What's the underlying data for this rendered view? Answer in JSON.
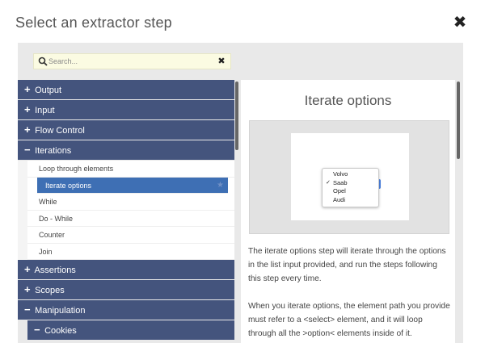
{
  "dialog": {
    "title": "Select an extractor step",
    "close_label": "✖"
  },
  "search": {
    "placeholder": "Search...",
    "clear_label": "✖"
  },
  "categories": [
    {
      "label": "Output",
      "sign": "+",
      "expanded": false
    },
    {
      "label": "Input",
      "sign": "+",
      "expanded": false
    },
    {
      "label": "Flow Control",
      "sign": "+",
      "expanded": false
    },
    {
      "label": "Iterations",
      "sign": "−",
      "expanded": true,
      "items": [
        {
          "label": "Loop through elements"
        },
        {
          "label": "Iterate options",
          "selected": true
        },
        {
          "label": "While"
        },
        {
          "label": "Do - While"
        },
        {
          "label": "Counter"
        },
        {
          "label": "Join"
        }
      ]
    },
    {
      "label": "Assertions",
      "sign": "+",
      "expanded": false
    },
    {
      "label": "Scopes",
      "sign": "+",
      "expanded": false
    },
    {
      "label": "Manipulation",
      "sign": "−",
      "expanded": true
    },
    {
      "label": "Cookies",
      "sign": "−",
      "expanded": true,
      "sub": true
    }
  ],
  "preview": {
    "title": "Iterate options",
    "options": [
      "Volvo",
      "Saab",
      "Opel",
      "Audi"
    ],
    "checked_option": "Saab",
    "description": [
      "The iterate options step will iterate through the options in the list input provided, and run the steps following this step every time.",
      "When you iterate options, the element path you provide must refer to a <select> element, and it will loop through all the >option< elements inside of it."
    ]
  },
  "colors": {
    "category_bg": "#44547d",
    "selected_bg": "#3e6fb4",
    "search_bg": "#fbfbe2"
  }
}
